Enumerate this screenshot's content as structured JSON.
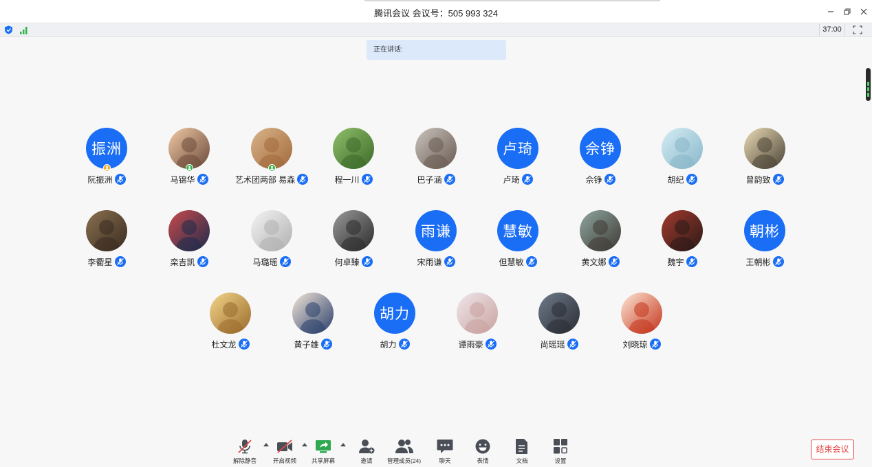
{
  "window": {
    "title": "腾讯会议 会议号：505 993 324",
    "minimize_icon": "minimize-icon",
    "restore_icon": "restore-icon",
    "close_icon": "close-icon"
  },
  "status_bar": {
    "timer": "37:00"
  },
  "speaking_label": "正在讲话:",
  "participants": [
    {
      "name": "阮振洲",
      "avatar_text": "振洲",
      "badge": "orange"
    },
    {
      "name": "马锦华",
      "avatar_text": "",
      "badge": "green"
    },
    {
      "name": "艺术团两部 易森",
      "avatar_text": "",
      "badge": "green"
    },
    {
      "name": "程一川",
      "avatar_text": ""
    },
    {
      "name": "巴子涵",
      "avatar_text": ""
    },
    {
      "name": "卢琦",
      "avatar_text": "卢琦"
    },
    {
      "name": "佘铮",
      "avatar_text": "佘铮"
    },
    {
      "name": "胡纪",
      "avatar_text": ""
    },
    {
      "name": "曾韵致",
      "avatar_text": ""
    },
    {
      "name": "李衢星",
      "avatar_text": ""
    },
    {
      "name": "栾吉凯",
      "avatar_text": ""
    },
    {
      "name": "马璐瑶",
      "avatar_text": ""
    },
    {
      "name": "何卓臻",
      "avatar_text": ""
    },
    {
      "name": "宋雨谦",
      "avatar_text": "雨谦"
    },
    {
      "name": "但慧敏",
      "avatar_text": "慧敏"
    },
    {
      "name": "黄文娜",
      "avatar_text": ""
    },
    {
      "name": "魏宇",
      "avatar_text": ""
    },
    {
      "name": "王朝彬",
      "avatar_text": "朝彬"
    },
    {
      "name": "杜文龙",
      "avatar_text": ""
    },
    {
      "name": "黄子雄",
      "avatar_text": ""
    },
    {
      "name": "胡力",
      "avatar_text": "胡力"
    },
    {
      "name": "谭雨豪",
      "avatar_text": ""
    },
    {
      "name": "尚瑶瑶",
      "avatar_text": ""
    },
    {
      "name": "刘晓琼",
      "avatar_text": ""
    }
  ],
  "toolbar": {
    "unmute": "解除静音",
    "start_video": "开启视频",
    "share_screen": "共享屏幕",
    "invite": "邀请",
    "manage_members": "管理成员(24)",
    "chat": "聊天",
    "reactions": "表情",
    "docs": "文档",
    "settings": "设置"
  },
  "end_meeting": "结束会议",
  "colors": {
    "accent": "#1a6ef5",
    "end_red": "#e54545",
    "speaking_bg": "#dbe9fb"
  }
}
